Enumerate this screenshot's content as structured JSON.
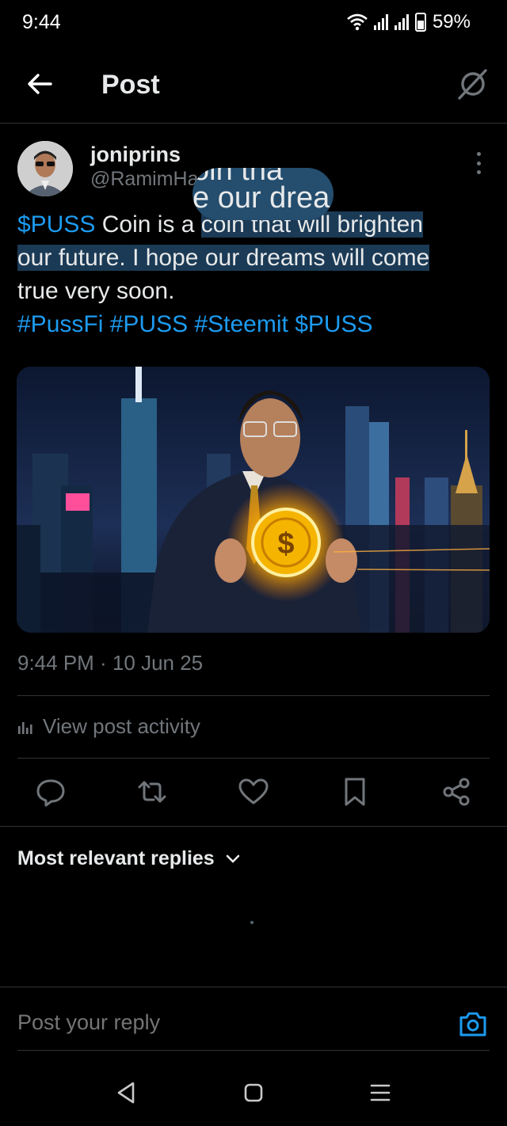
{
  "status_bar": {
    "time": "9:44",
    "battery": "59%"
  },
  "header": {
    "title": "Post"
  },
  "post": {
    "author_name": "joniprins",
    "author_handle": "@RamimHa",
    "lines": [
      {
        "cashtag": "$PUSS",
        "t1": " Coin is a ",
        "t2": "coin that",
        "t3": " will brighten"
      },
      {
        "text": "our future. I hope our dreams will come"
      },
      {
        "text": "true very soon."
      }
    ],
    "tags": [
      "#PussFi",
      "#PUSS",
      "#Steemit",
      "$PUSS"
    ],
    "magnifier_text": "e our drea",
    "magnifier_ghost": "oin tha",
    "timestamp": "9:44 PM · 10 Jun 25"
  },
  "activity_label": "View post activity",
  "actions": {
    "reply": "reply-icon",
    "repost": "repost-icon",
    "like": "heart-icon",
    "bookmark": "bookmark-icon",
    "share": "share-icon"
  },
  "replies": {
    "sort_label": "Most relevant replies"
  },
  "composer": {
    "placeholder": "Post your reply"
  },
  "colors": {
    "accent": "#1d9bf0",
    "muted": "#71767b",
    "selection": "#1b3a55"
  }
}
